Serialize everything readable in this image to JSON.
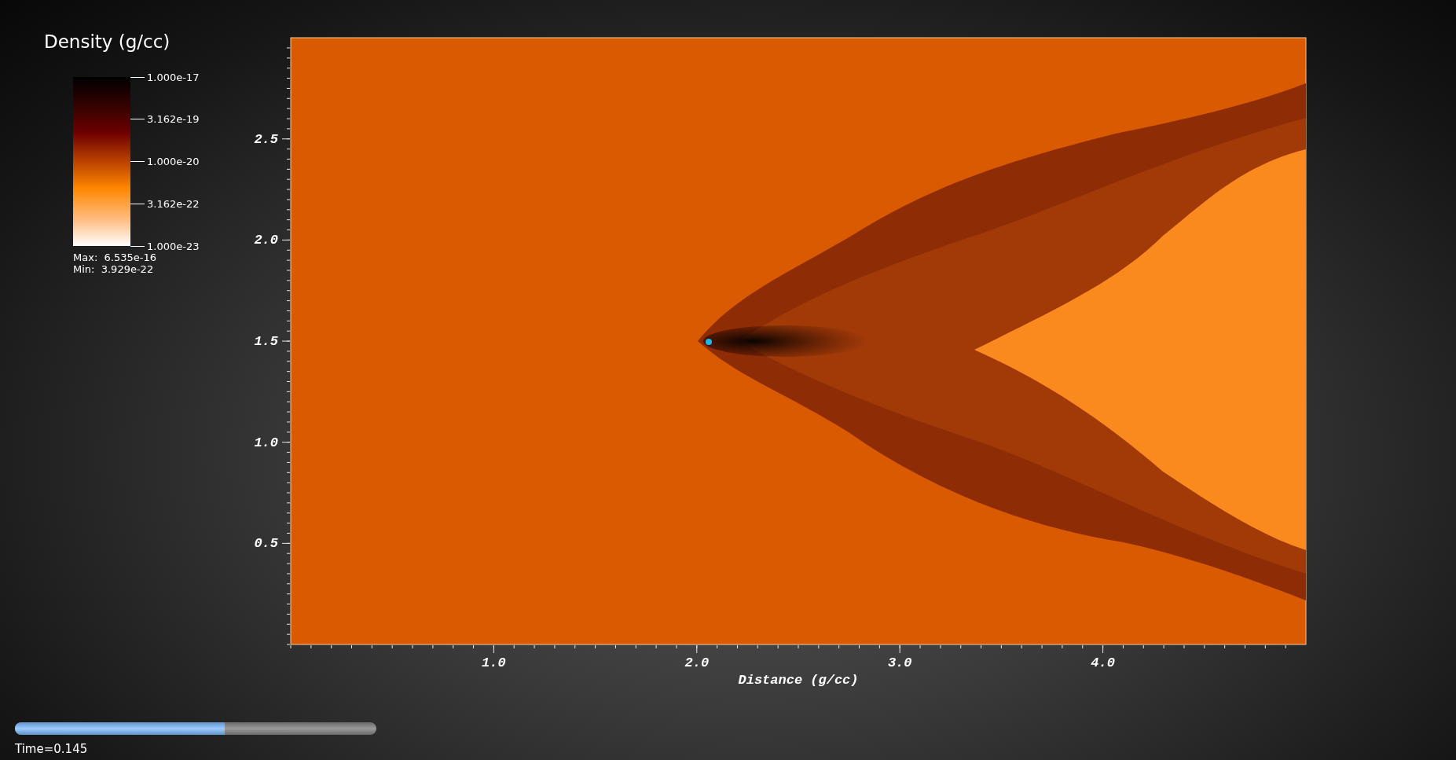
{
  "legend": {
    "title": "Density (g/cc)",
    "ticks": [
      "1.000e-17",
      "3.162e-19",
      "1.000e-20",
      "3.162e-22",
      "1.000e-23"
    ],
    "max": "Max:  6.535e-16",
    "min": "Min:  3.929e-22"
  },
  "plot": {
    "y_ticks": [
      "2.5",
      "2.0",
      "1.5",
      "1.0",
      "0.5"
    ],
    "x_ticks": [
      "1.0",
      "2.0",
      "3.0",
      "4.0"
    ],
    "xlabel": "Distance (g/cc)"
  },
  "time_slider": {
    "level": 0.58,
    "label": "Time=0.145"
  }
}
